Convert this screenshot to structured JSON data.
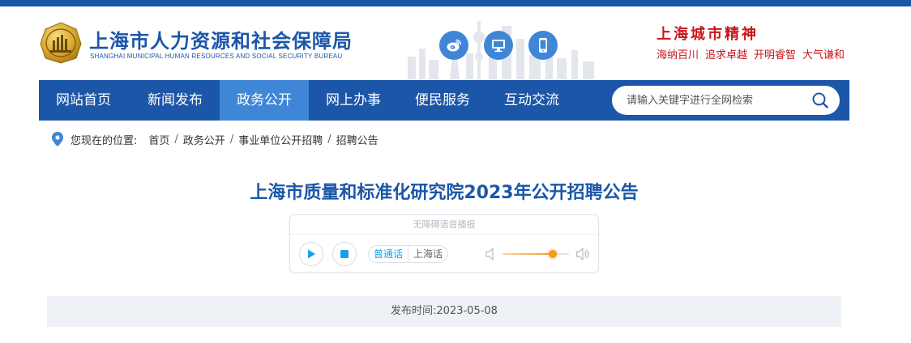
{
  "header": {
    "site_title": "上海市人力资源和社会保障局",
    "site_subtitle": "SHANGHAI MUNICIPAL HUMAN RESOURCES AND SOCIAL SECURITY BUREAU",
    "quick_icons": [
      "weibo-icon",
      "computer-icon",
      "mobile-icon"
    ],
    "spirit_title": "上海城市精神",
    "spirit_words": [
      "海纳百川",
      "追求卓越",
      "开明睿智",
      "大气谦和"
    ]
  },
  "nav": {
    "items": [
      {
        "label": "网站首页",
        "active": false
      },
      {
        "label": "新闻发布",
        "active": false
      },
      {
        "label": "政务公开",
        "active": true
      },
      {
        "label": "网上办事",
        "active": false
      },
      {
        "label": "便民服务",
        "active": false
      },
      {
        "label": "互动交流",
        "active": false
      }
    ],
    "search_placeholder": "请输入关键字进行全网检索"
  },
  "breadcrumb": {
    "label": "您现在的位置:",
    "items": [
      "首页",
      "政务公开",
      "事业单位公开招聘",
      "招聘公告"
    ]
  },
  "article": {
    "title": "上海市质量和标准化研究院2023年公开招聘公告",
    "publish_label": "发布时间:",
    "publish_date": "2023-05-08"
  },
  "player": {
    "caption": "无障碍语音播报",
    "languages": [
      "普通话",
      "上海话"
    ],
    "selected_language": "普通话",
    "volume_fraction": 0.75
  },
  "colors": {
    "brand_blue": "#1c56a8",
    "nav_active": "#3f87d6",
    "spirit_red": "#c8161d",
    "accent_orange": "#f39a1c",
    "player_blue": "#1aa0e8"
  }
}
